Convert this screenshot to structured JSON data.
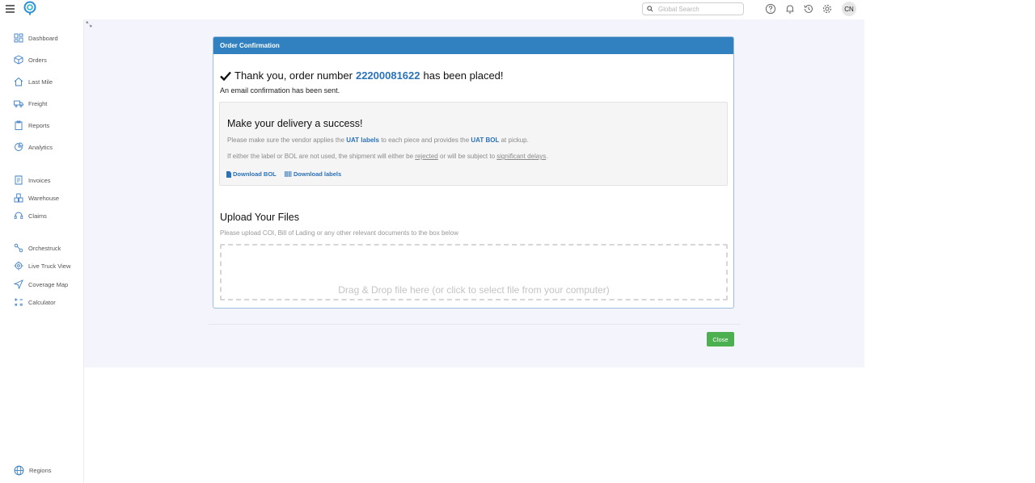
{
  "topbar": {
    "search_placeholder": "Global Search",
    "avatar_initials": "CN",
    "icons": [
      "menu-icon",
      "brand-logo",
      "search-icon",
      "help-icon",
      "bell-icon",
      "history-icon",
      "gear-icon"
    ]
  },
  "sidebar": {
    "items": [
      {
        "label": "Dashboard",
        "icon": "dashboard-icon"
      },
      {
        "label": "Orders",
        "icon": "box-icon"
      },
      {
        "label": "Last Mile",
        "icon": "house-icon"
      },
      {
        "label": "Freight",
        "icon": "truck-icon"
      },
      {
        "label": "Reports",
        "icon": "clipboard-icon"
      },
      {
        "label": "Analytics",
        "icon": "pie-chart-icon"
      },
      {
        "label": "Invoices",
        "icon": "invoice-icon"
      },
      {
        "label": "Warehouse",
        "icon": "warehouse-icon"
      },
      {
        "label": "Claims",
        "icon": "headset-icon"
      },
      {
        "label": "Orchestruck",
        "icon": "nodes-icon"
      },
      {
        "label": "Live Truck View",
        "icon": "target-icon"
      },
      {
        "label": "Coverage Map",
        "icon": "navigation-icon"
      },
      {
        "label": "Calculator",
        "icon": "calculator-icon"
      }
    ],
    "footer": {
      "label": "Regions",
      "icon": "globe-icon"
    }
  },
  "confirmation": {
    "header": "Order Confirmation",
    "thanks_prefix": "Thank you, order number",
    "order_number": "22200081622",
    "thanks_suffix": "has been placed!",
    "email_note": "An email confirmation has been sent."
  },
  "notice": {
    "title": "Make your delivery a success!",
    "line1_a": "Please make sure the vendor applies the",
    "line1_labels": "UAT labels",
    "line1_b": "to each piece and provides the",
    "line1_bol": "UAT BOL",
    "line1_c": "at pickup.",
    "line2_a": "If either the label or BOL are not used, the shipment will either be",
    "line2_rejected": "rejected",
    "line2_b": "or will be subject to",
    "line2_delays": "significant delays",
    "line2_c": ".",
    "download_bol": "Download BOL",
    "download_labels": "Download labels"
  },
  "upload": {
    "title": "Upload Your Files",
    "subtitle": "Please upload COI, Bill of Lading or any other relevant documents to the box below",
    "dropzone_text": "Drag & Drop file here (or click to select file from your computer)"
  },
  "footer": {
    "close_label": "Close"
  },
  "colors": {
    "accent": "#3180c0",
    "link": "#2b72b9",
    "success": "#4cb050",
    "main_bg": "#f4f5fc"
  }
}
